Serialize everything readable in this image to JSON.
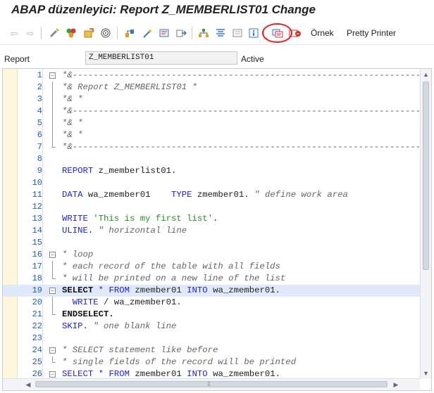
{
  "window": {
    "title": "ABAP düzenleyici: Report Z_MEMBERLIST01 Change"
  },
  "toolbar": {
    "icons": [
      "back-arrow-icon",
      "forward-arrow-icon",
      "display-change-toggle-icon",
      "other-object-icon",
      "activate-icon",
      "object-list-icon",
      "where-used-icon",
      "navigation-icon",
      "wizard-icon",
      "enhancement-icon",
      "pattern-icon",
      "find-icon",
      "pretty-printer-tree-icon",
      "info-icon",
      "display-object-list-icon",
      "test-run-icon",
      "stop-icon"
    ],
    "example_label": "Örnek",
    "pretty_printer_label": "Pretty Printer"
  },
  "header": {
    "report_label": "Report",
    "report_value": "Z_MEMBERLIST01",
    "status": "Active"
  },
  "editor": {
    "line_numbers": [
      "1",
      "2",
      "3",
      "4",
      "5",
      "6",
      "7",
      "8",
      "9",
      "10",
      "11",
      "12",
      "13",
      "14",
      "15",
      "16",
      "17",
      "18",
      "19",
      "20",
      "21",
      "22",
      "23",
      "24",
      "25",
      "26"
    ],
    "current_line": "19",
    "lines": [
      "*&---------------------------------------------------------------------*",
      "*& Report Z_MEMBERLIST01 *",
      "*& *",
      "*&---------------------------------------------------------------------*",
      "*& *",
      "*& *",
      "*&---------------------------------------------------------------------*",
      "",
      "REPORT z_memberlist01.",
      "",
      "DATA wa_zmember01    TYPE zmember01. \" define work area",
      "",
      "WRITE 'This is my first list'.",
      "ULINE. \" horizontal line",
      "",
      "* loop",
      "* each record of the table with all fields",
      "* will be printed on a new line of the list",
      "SELECT * FROM zmember01 INTO wa_zmember01.",
      "  WRITE / wa_zmember01.",
      "ENDSELECT.",
      "SKIP. \" one blank line",
      "",
      "* SELECT statement like before",
      "* single fields of the record will be printed",
      "SELECT * FROM zmember01 INTO wa_zmember01."
    ]
  },
  "colors": {
    "keyword": "#1e24c8",
    "string": "#2a8a2a",
    "comment": "#666666",
    "current_line_bg": "#dfe9f7",
    "highlight_circle": "#e02020"
  }
}
